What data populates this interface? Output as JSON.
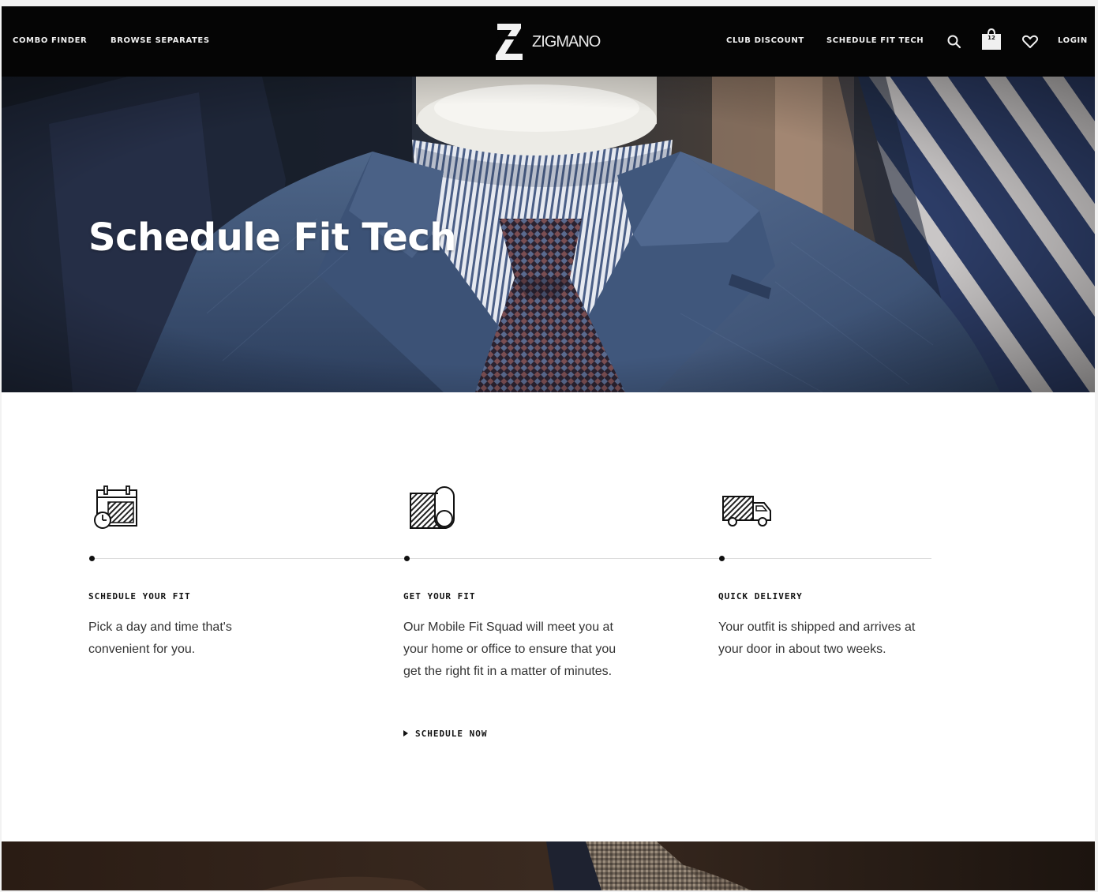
{
  "nav": {
    "left_links": [
      "COMBO FINDER",
      "BROWSE SEPARATES"
    ],
    "brand": "ZIGMANO",
    "right_links": [
      "CLUB DISCOUNT",
      "SCHEDULE FIT TECH"
    ],
    "cart_count": "12",
    "login_label": "LOGIN",
    "icons": [
      "search-icon",
      "shopping-bag-icon",
      "heart-icon"
    ]
  },
  "hero": {
    "title": "Schedule Fit Tech"
  },
  "steps": [
    {
      "icon": "calendar-clock-icon",
      "title": "SCHEDULE YOUR FIT",
      "text": "Pick a day and time that's convenient for you."
    },
    {
      "icon": "fabric-roll-icon",
      "title": "GET YOUR FIT",
      "text": "Our Mobile Fit Squad will meet you at your home or office to ensure that you get the right fit in a matter of minutes.",
      "cta": "SCHEDULE NOW"
    },
    {
      "icon": "delivery-truck-icon",
      "title": "QUICK DELIVERY",
      "text": "Your outfit is shipped and arrives at your door in about two weeks."
    }
  ],
  "colors": {
    "nav_bg": "#050505",
    "page_bg": "#ffffff",
    "text": "#333333",
    "suit_blue": "#3f5577"
  }
}
